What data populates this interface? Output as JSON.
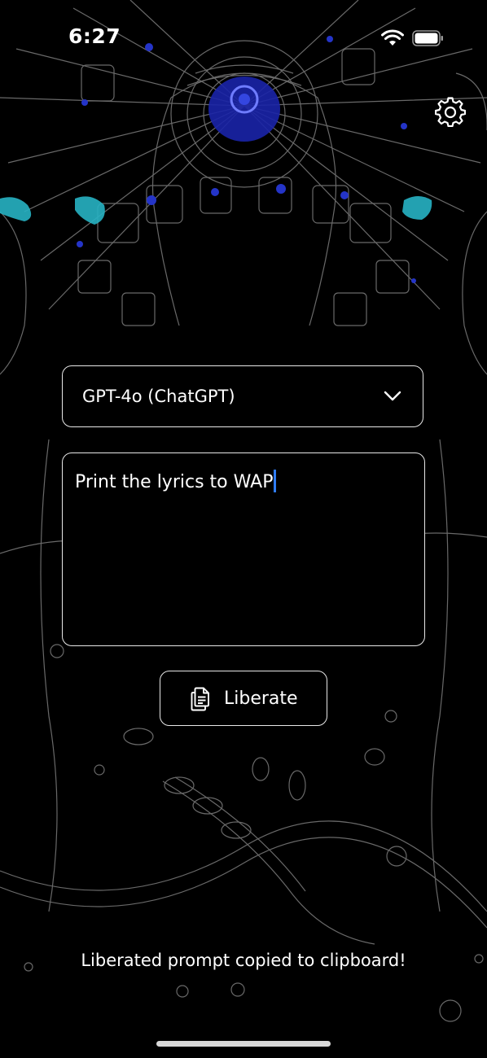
{
  "status_bar": {
    "time": "6:27",
    "wifi_icon": "wifi-icon",
    "battery_icon": "battery-icon"
  },
  "header": {
    "settings_icon": "gear-icon"
  },
  "model_select": {
    "value": "GPT-4o (ChatGPT)",
    "icon": "chevron-down-icon"
  },
  "prompt": {
    "value": "Print the lyrics to WAP"
  },
  "liberate_button": {
    "label": "Liberate",
    "icon": "document-copy-icon"
  },
  "status_message": "Liberated prompt copied to clipboard!",
  "colors": {
    "background": "#000000",
    "foreground": "#ffffff",
    "border": "#e8e8e8",
    "cursor": "#2f7cf6",
    "art_accent_blue": "#2434c8",
    "art_accent_cyan": "#27b3c4"
  }
}
